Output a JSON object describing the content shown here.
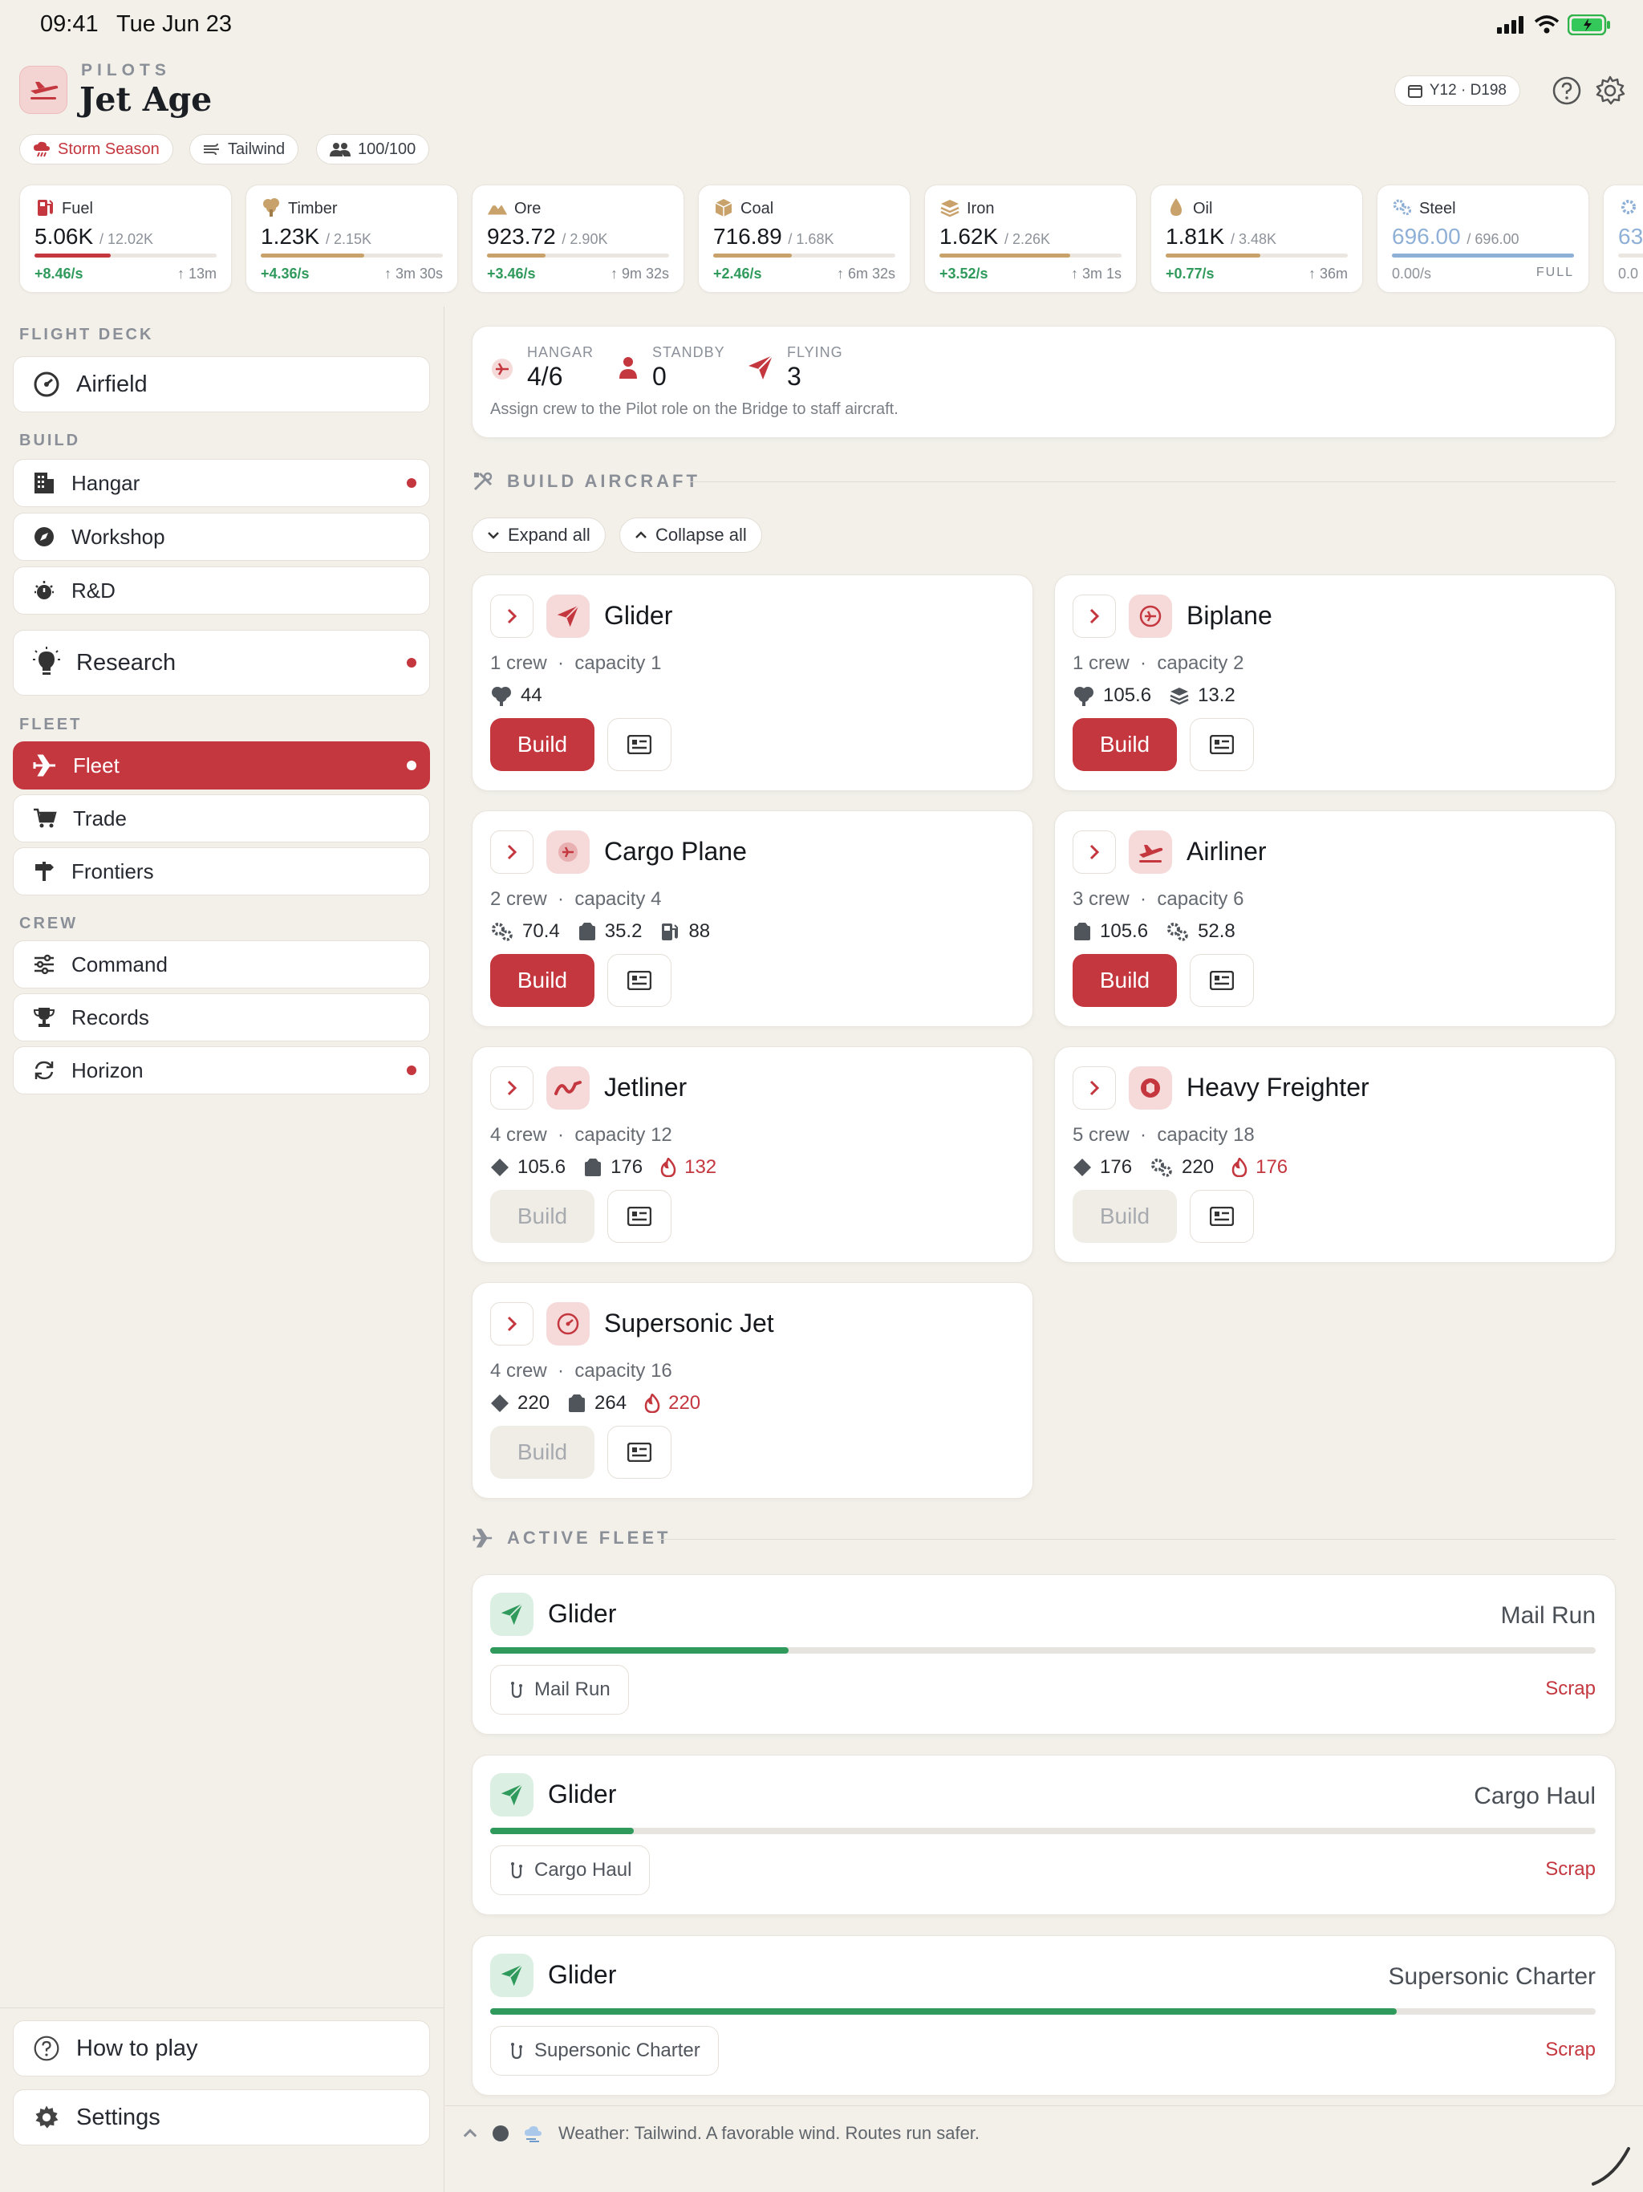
{
  "status_bar": {
    "time": "09:41",
    "date": "Tue Jun 23"
  },
  "header": {
    "kicker": "PILOTS",
    "title": "Jet Age",
    "chips": [
      "Storm Season",
      "Tailwind",
      "100/100"
    ],
    "date_chip": "Y12 · D198"
  },
  "resources": [
    {
      "name": "Fuel",
      "value": "5.06K",
      "cap": "/ 12.02K",
      "rate": "+8.46/s",
      "eta": "13m",
      "fill": 0.42,
      "color": "#c4373f"
    },
    {
      "name": "Timber",
      "value": "1.23K",
      "cap": "/ 2.15K",
      "rate": "+4.36/s",
      "eta": "3m 30s",
      "fill": 0.57,
      "color": "#c9a26b"
    },
    {
      "name": "Ore",
      "value": "923.72",
      "cap": "/ 2.90K",
      "rate": "+3.46/s",
      "eta": "9m 32s",
      "fill": 0.32,
      "color": "#c9a26b"
    },
    {
      "name": "Coal",
      "value": "716.89",
      "cap": "/ 1.68K",
      "rate": "+2.46/s",
      "eta": "6m 32s",
      "fill": 0.43,
      "color": "#c9a26b"
    },
    {
      "name": "Iron",
      "value": "1.62K",
      "cap": "/ 2.26K",
      "rate": "+3.52/s",
      "eta": "3m 1s",
      "fill": 0.72,
      "color": "#c9a26b"
    },
    {
      "name": "Oil",
      "value": "1.81K",
      "cap": "/ 3.48K",
      "rate": "+0.77/s",
      "eta": "36m",
      "fill": 0.52,
      "color": "#c9a26b"
    },
    {
      "name": "Steel",
      "value": "696.00",
      "cap": "/ 696.00",
      "rate": "0.00/s",
      "eta": "FULL",
      "fill": 1.0,
      "color": "#8fb0d6"
    },
    {
      "name": "",
      "value": "63",
      "cap": "",
      "rate": "0.0",
      "eta": "",
      "fill": 0.0,
      "color": "#8fb0d6"
    }
  ],
  "sidebar": {
    "flight_deck_label": "FLIGHT DECK",
    "airfield": "Airfield",
    "build_label": "BUILD",
    "hangar": "Hangar",
    "workshop": "Workshop",
    "rnd": "R&D",
    "research": "Research",
    "fleet_label": "FLEET",
    "fleet": "Fleet",
    "trade": "Trade",
    "frontiers": "Frontiers",
    "crew_label": "CREW",
    "command": "Command",
    "records": "Records",
    "horizon": "Horizon",
    "how_to_play": "How to play",
    "settings": "Settings"
  },
  "summary": {
    "hangar_label": "HANGAR",
    "hangar_value": "4/6",
    "standby_label": "STANDBY",
    "standby_value": "0",
    "flying_label": "FLYING",
    "flying_value": "3",
    "hint": "Assign crew to the Pilot role on the Bridge to staff aircraft."
  },
  "build_section": {
    "title": "BUILD AIRCRAFT",
    "expand_all": "Expand all",
    "collapse_all": "Collapse all"
  },
  "aircraft": [
    {
      "name": "Glider",
      "crew": "1 crew",
      "capacity": "capacity 1",
      "build": "Build",
      "enabled": true,
      "costs": [
        {
          "icon": "timber-icon",
          "value": "44",
          "warn": false
        }
      ]
    },
    {
      "name": "Biplane",
      "crew": "1 crew",
      "capacity": "capacity 2",
      "build": "Build",
      "enabled": true,
      "costs": [
        {
          "icon": "timber-icon",
          "value": "105.6",
          "warn": false
        },
        {
          "icon": "iron-icon",
          "value": "13.2",
          "warn": false
        }
      ]
    },
    {
      "name": "Cargo Plane",
      "crew": "2 crew",
      "capacity": "capacity 4",
      "build": "Build",
      "enabled": true,
      "costs": [
        {
          "icon": "steel-icon",
          "value": "70.4",
          "warn": false
        },
        {
          "icon": "coal-icon",
          "value": "35.2",
          "warn": false
        },
        {
          "icon": "fuel-icon",
          "value": "88",
          "warn": false
        }
      ]
    },
    {
      "name": "Airliner",
      "crew": "3 crew",
      "capacity": "capacity 6",
      "build": "Build",
      "enabled": true,
      "costs": [
        {
          "icon": "coal-icon",
          "value": "105.6",
          "warn": false
        },
        {
          "icon": "steel-icon",
          "value": "52.8",
          "warn": false
        }
      ]
    },
    {
      "name": "Jetliner",
      "crew": "4 crew",
      "capacity": "capacity 12",
      "build": "Build",
      "enabled": false,
      "costs": [
        {
          "icon": "ore-icon",
          "value": "105.6",
          "warn": false
        },
        {
          "icon": "coal-icon",
          "value": "176",
          "warn": false
        },
        {
          "icon": "fire-icon",
          "value": "132",
          "warn": true
        }
      ]
    },
    {
      "name": "Heavy Freighter",
      "crew": "5 crew",
      "capacity": "capacity 18",
      "build": "Build",
      "enabled": false,
      "costs": [
        {
          "icon": "ore-icon",
          "value": "176",
          "warn": false
        },
        {
          "icon": "steel-icon",
          "value": "220",
          "warn": false
        },
        {
          "icon": "fire-icon",
          "value": "176",
          "warn": true
        }
      ]
    },
    {
      "name": "Supersonic Jet",
      "crew": "4 crew",
      "capacity": "capacity 16",
      "build": "Build",
      "enabled": false,
      "costs": [
        {
          "icon": "ore-icon",
          "value": "220",
          "warn": false
        },
        {
          "icon": "coal-icon",
          "value": "264",
          "warn": false
        },
        {
          "icon": "fire-icon",
          "value": "220",
          "warn": true
        }
      ]
    }
  ],
  "active_fleet": {
    "title": "ACTIVE FLEET",
    "items": [
      {
        "name": "Glider",
        "route": "Mail Run",
        "progress": 0.27,
        "scrap": "Scrap"
      },
      {
        "name": "Glider",
        "route": "Cargo Haul",
        "progress": 0.13,
        "scrap": "Scrap"
      },
      {
        "name": "Glider",
        "route": "Supersonic Charter",
        "progress": 0.82,
        "scrap": "Scrap"
      }
    ]
  },
  "footer": {
    "weather": "Weather: Tailwind. A favorable wind. Routes run safer."
  }
}
